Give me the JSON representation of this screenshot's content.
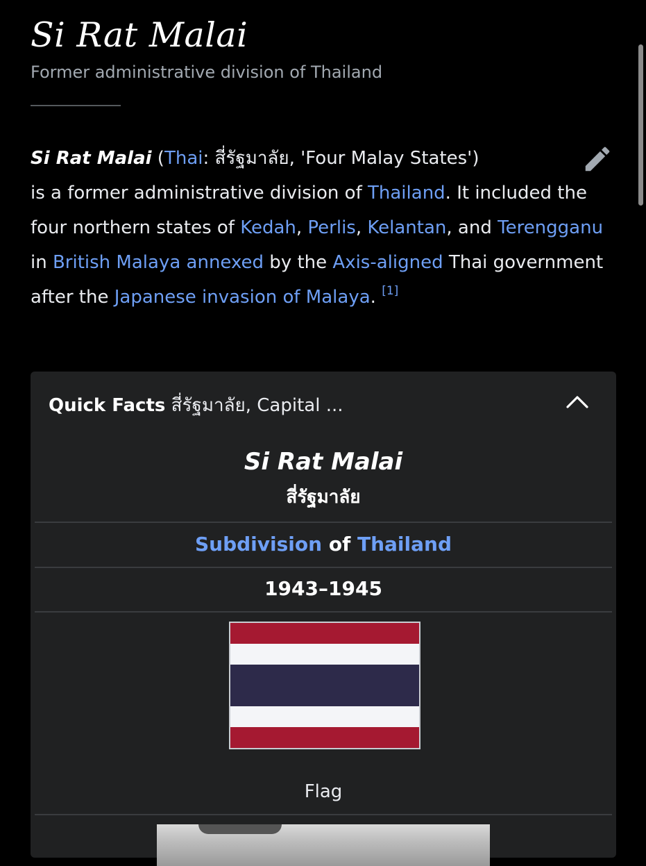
{
  "page": {
    "title": "Si Rat Malai",
    "description": "Former administrative division of Thailand"
  },
  "lead": {
    "term": "Si Rat Malai",
    "open_paren": " (",
    "lang_link": "Thai",
    "native_text": ": สี่รัฐมาลัย, 'Four Malay States')",
    "t1": "is a former administrative division of ",
    "link_thailand": "Thailand",
    "t2": ". It included the four northern states of ",
    "link_kedah": "Kedah",
    "sep1": ", ",
    "link_perlis": "Perlis",
    "sep2": ", ",
    "link_kelantan": "Kelantan",
    "t3": ", and ",
    "link_terengganu": "Terengganu",
    "t4": " in ",
    "link_british_malaya": "British Malaya annexed",
    "t5": " by the ",
    "link_axis": "Axis-aligned",
    "t6": " Thai government after the ",
    "link_invasion": "Japanese invasion of Malaya",
    "t7": ".",
    "ref": "[1]"
  },
  "infobox": {
    "header_label": "Quick Facts",
    "header_summary": " สี่รัฐมาลัย, Capital ...",
    "name": "Si Rat Malai",
    "native_name": "สี่รัฐมาลัย",
    "subdivision_link": "Subdivision",
    "of": " of ",
    "country_link": "Thailand",
    "years": "1943–1945",
    "flag_caption": "Flag",
    "flag_colors": [
      "#a51931",
      "#f4f5f8",
      "#2d2a4a",
      "#f4f5f8",
      "#a51931"
    ]
  },
  "icons": {
    "edit": "pencil-icon",
    "collapse": "chevron-up-icon"
  }
}
